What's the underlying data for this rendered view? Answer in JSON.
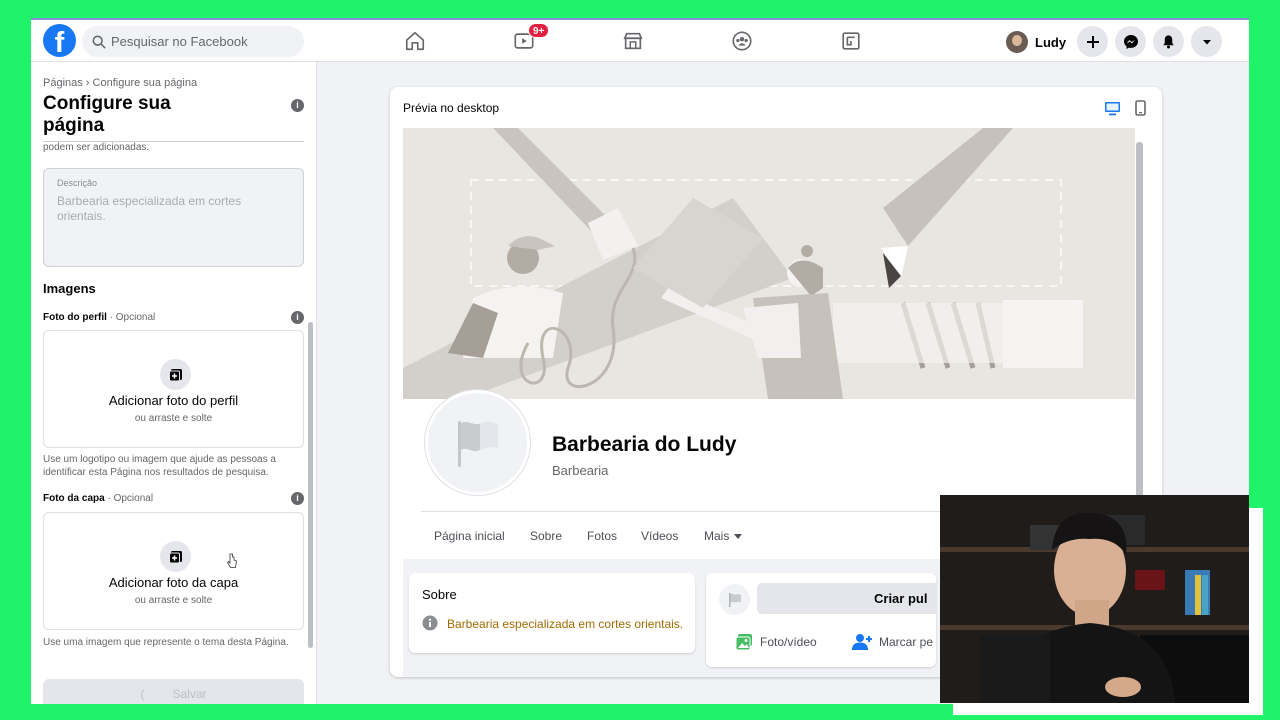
{
  "topbar": {
    "search_placeholder": "Pesquisar no Facebook",
    "watch_badge": "9+",
    "profile_name": "Ludy",
    "nav_icons": [
      "home-icon",
      "watch-icon",
      "marketplace-icon",
      "groups-icon",
      "gaming-icon"
    ],
    "action_icons": [
      "plus-icon",
      "messenger-icon",
      "bell-icon",
      "caret-icon"
    ]
  },
  "sidebar": {
    "breadcrumb": "Páginas › Configure sua página",
    "title": "Configure sua página",
    "cut_text": "podem ser adicionadas.",
    "description": {
      "label": "Descrição",
      "value": "Barbearia especializada em cortes orientais."
    },
    "images_title": "Imagens",
    "profile_photo": {
      "label": "Foto do perfil",
      "optional": " · Opcional",
      "add_label": "Adicionar foto do perfil",
      "drag_label": "ou arraste e solte",
      "help": "Use um logotipo ou imagem que ajude as pessoas a identificar esta Página nos resultados de pesquisa."
    },
    "cover_photo": {
      "label": "Foto da capa",
      "optional": " · Opcional",
      "add_label": "Adicionar foto da capa",
      "drag_label": "ou arraste e solte",
      "help": "Use uma imagem que represente o tema desta Página."
    },
    "save_label": "Salvar"
  },
  "preview": {
    "title": "Prévia no desktop",
    "page_name": "Barbearia do Ludy",
    "category": "Barbearia",
    "tabs": [
      "Página inicial",
      "Sobre",
      "Fotos",
      "Vídeos",
      "Mais"
    ],
    "about_title": "Sobre",
    "about_text": "Barbearia especializada em cortes orientais.",
    "create_post": "Criar pul",
    "photo_video": "Foto/vídeo",
    "tag_people": "Marcar pe"
  },
  "colors": {
    "facebook_blue": "#1877f2",
    "background": "#f0f2f5",
    "chroma_green": "#1ef36a"
  }
}
